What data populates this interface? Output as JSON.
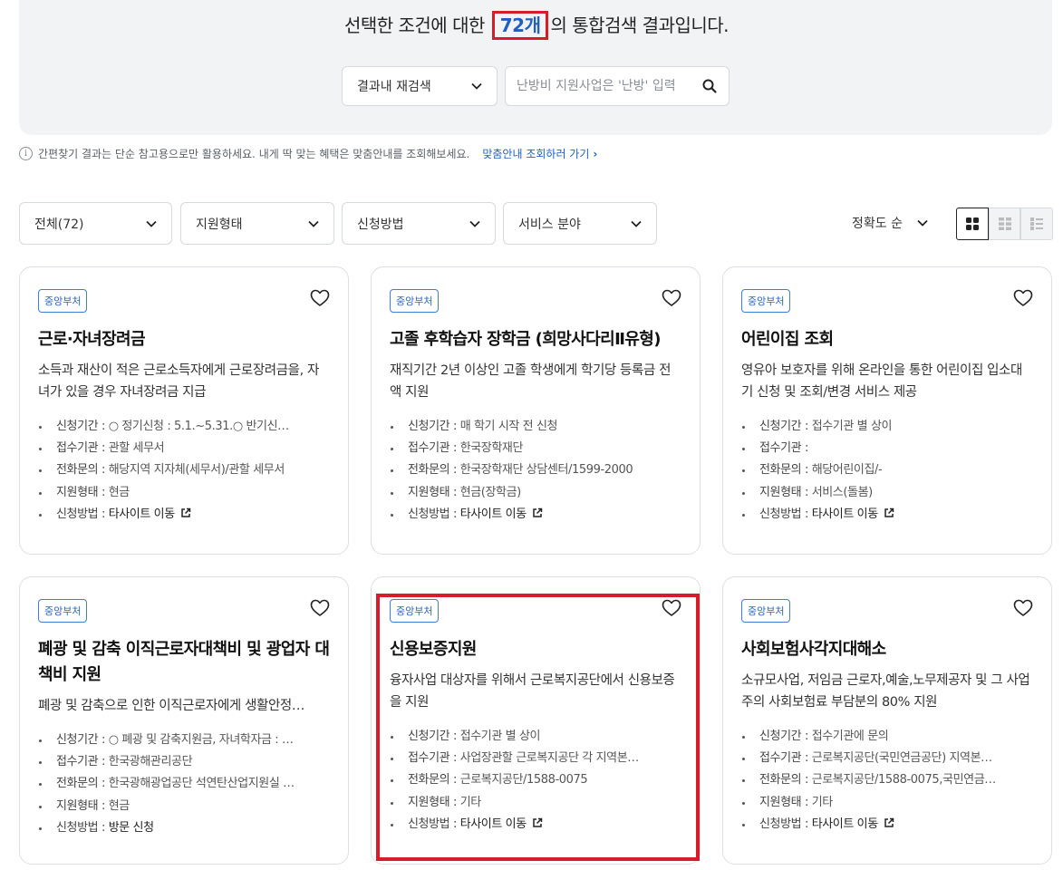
{
  "header": {
    "prefix": "선택한 조건에 대한 ",
    "count": "72개",
    "suffix": "의 통합검색 결과입니다."
  },
  "search": {
    "scope_label": "결과내 재검색",
    "placeholder": "난방비 지원사업은 '난방' 입력"
  },
  "notice": {
    "text": "간편찾기 결과는 단순 참고용으로만 활용하세요. 내게 딱 맞는 혜택은 맞춤안내를 조회해보세요.",
    "link": "맞춤안내 조회하러 가기"
  },
  "filters": [
    "전체(72)",
    "지원형태",
    "신청방법",
    "서비스 분야"
  ],
  "sort": {
    "label": "정확도 순"
  },
  "colors": {
    "accent": "#1f5fbf",
    "highlight": "#d81d2a"
  },
  "cards": [
    {
      "badge": "중앙부처",
      "title": "근로·자녀장려금",
      "desc": "소득과 재산이 적은 근로소득자에게 근로장려금을, 자녀가 있을 경우 자녀장려금 지급",
      "period_label": "신청기간 : ",
      "period": "○ 정기신청 : 5.1.~5.31.○ 반기신…",
      "org_label": "접수기관 : ",
      "org": "관할 세무서",
      "phone_label": "전화문의 : ",
      "phone": "해당지역 지자체(세무서)/관할 세무서",
      "type_label": "지원형태 : ",
      "type": "현금",
      "method_label": "신청방법 : ",
      "method": "타사이트 이동"
    },
    {
      "badge": "중앙부처",
      "title": "고졸 후학습자 장학금 (희망사다리Ⅱ유형)",
      "desc": "재직기간 2년 이상인 고졸 학생에게 학기당 등록금 전액 지원",
      "period_label": "신청기간 : ",
      "period": "매 학기 시작 전 신청",
      "org_label": "접수기관 : ",
      "org": "한국장학재단",
      "phone_label": "전화문의 : ",
      "phone": "한국장학재단 상담센터/1599-2000",
      "type_label": "지원형태 : ",
      "type": "현금(장학금)",
      "method_label": "신청방법 : ",
      "method": "타사이트 이동"
    },
    {
      "badge": "중앙부처",
      "title": "어린이집 조회",
      "desc": "영유아 보호자를 위해 온라인을 통한 어린이집 입소대기 신청 및 조회/변경 서비스 제공",
      "period_label": "신청기간 : ",
      "period": "접수기관 별 상이",
      "org_label": "접수기관 : ",
      "org": "",
      "phone_label": "전화문의 : ",
      "phone": "해당어린이집/-",
      "type_label": "지원형태 : ",
      "type": "서비스(돌봄)",
      "method_label": "신청방법 : ",
      "method": "타사이트 이동"
    },
    {
      "badge": "중앙부처",
      "title": "폐광 및 감축 이직근로자대책비 및 광업자 대책비 지원",
      "desc": "폐광 및 감축으로 인한 이직근로자에게 생활안정…",
      "period_label": "신청기간 : ",
      "period": "○ 폐광 및 감축지원금, 자녀학자금 : …",
      "org_label": "접수기관 : ",
      "org": "한국광해관리공단",
      "phone_label": "전화문의 : ",
      "phone": "한국광해광업공단 석연탄산업지원실 …",
      "type_label": "지원형태 : ",
      "type": "현금",
      "method_label": "신청방법 : ",
      "method": "방문 신청"
    },
    {
      "badge": "중앙부처",
      "title": "신용보증지원",
      "desc": "융자사업 대상자를 위해서 근로복지공단에서 신용보증을 지원",
      "period_label": "신청기간 : ",
      "period": "접수기관 별 상이",
      "org_label": "접수기관 : ",
      "org": "사업장관할 근로복지공단 각 지역본…",
      "phone_label": "전화문의 : ",
      "phone": "근로복지공단/1588-0075",
      "type_label": "지원형태 : ",
      "type": "기타",
      "method_label": "신청방법 : ",
      "method": "타사이트 이동"
    },
    {
      "badge": "중앙부처",
      "title": "사회보험사각지대해소",
      "desc": "소규모사업, 저임금 근로자,예술,노무제공자 및 그 사업주의 사회보험료 부담분의 80% 지원",
      "period_label": "신청기간 : ",
      "period": "접수기관에 문의",
      "org_label": "접수기관 : ",
      "org": "근로복지공단(국민연금공단) 지역본…",
      "phone_label": "전화문의 : ",
      "phone": "근로복지공단/1588-0075,국민연금…",
      "type_label": "지원형태 : ",
      "type": "기타",
      "method_label": "신청방법 : ",
      "method": "타사이트 이동"
    }
  ]
}
